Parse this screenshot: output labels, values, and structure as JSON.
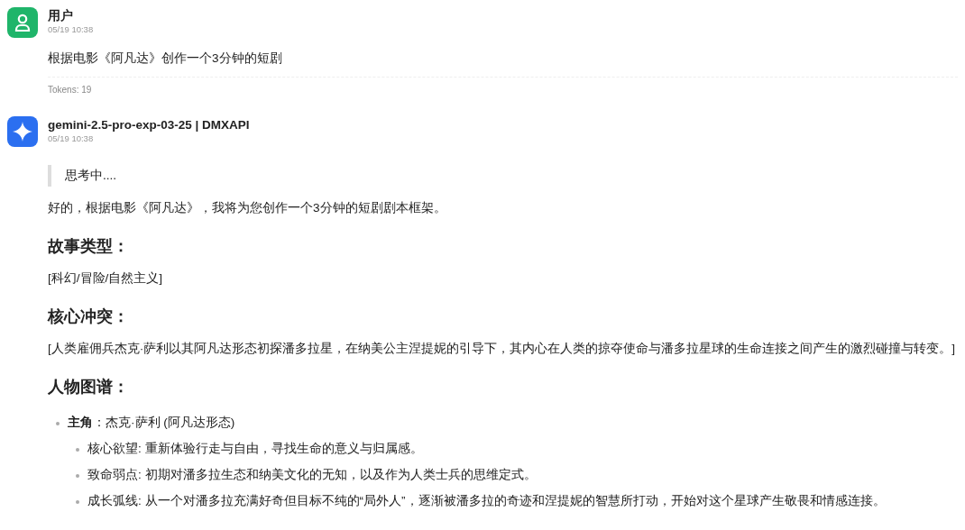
{
  "messages": [
    {
      "kind": "user",
      "sender": "用户",
      "time": "05/19 10:38",
      "blocks": [
        {
          "kind": "paragraph",
          "text": "根据电影《阿凡达》创作一个3分钟的短剧"
        }
      ],
      "tokens": "Tokens: 19"
    },
    {
      "kind": "assistant",
      "sender": "gemini-2.5-pro-exp-03-25 | DMXAPI",
      "time": "05/19 10:38",
      "blocks": [
        {
          "kind": "quote",
          "text": "思考中...."
        },
        {
          "kind": "paragraph",
          "text": "好的，根据电影《阿凡达》，我将为您创作一个3分钟的短剧剧本框架。"
        },
        {
          "kind": "heading",
          "text": "故事类型："
        },
        {
          "kind": "paragraph",
          "text": "[科幻/冒险/自然主义]"
        },
        {
          "kind": "heading",
          "text": "核心冲突："
        },
        {
          "kind": "paragraph",
          "text": "[人类雇佣兵杰克·萨利以其阿凡达形态初探潘多拉星，在纳美公主涅提妮的引导下，其内心在人类的掠夺使命与潘多拉星球的生命连接之间产生的激烈碰撞与转变。]"
        },
        {
          "kind": "heading",
          "text": "人物图谱："
        },
        {
          "kind": "list",
          "items": [
            {
              "text": "**主角**：杰克·萨利 (阿凡达形态)",
              "children": [
                {
                  "text": "核心欲望: 重新体验行走与自由，寻找生命的意义与归属感。"
                },
                {
                  "text": "致命弱点: 初期对潘多拉生态和纳美文化的无知，以及作为人类士兵的思维定式。"
                },
                {
                  "text": "成长弧线: 从一个对潘多拉充满好奇但目标不纯的“局外人”，逐渐被潘多拉的奇迹和涅提妮的智慧所打动，开始对这个星球产生敬畏和情感连接。"
                }
              ]
            }
          ]
        }
      ]
    }
  ]
}
